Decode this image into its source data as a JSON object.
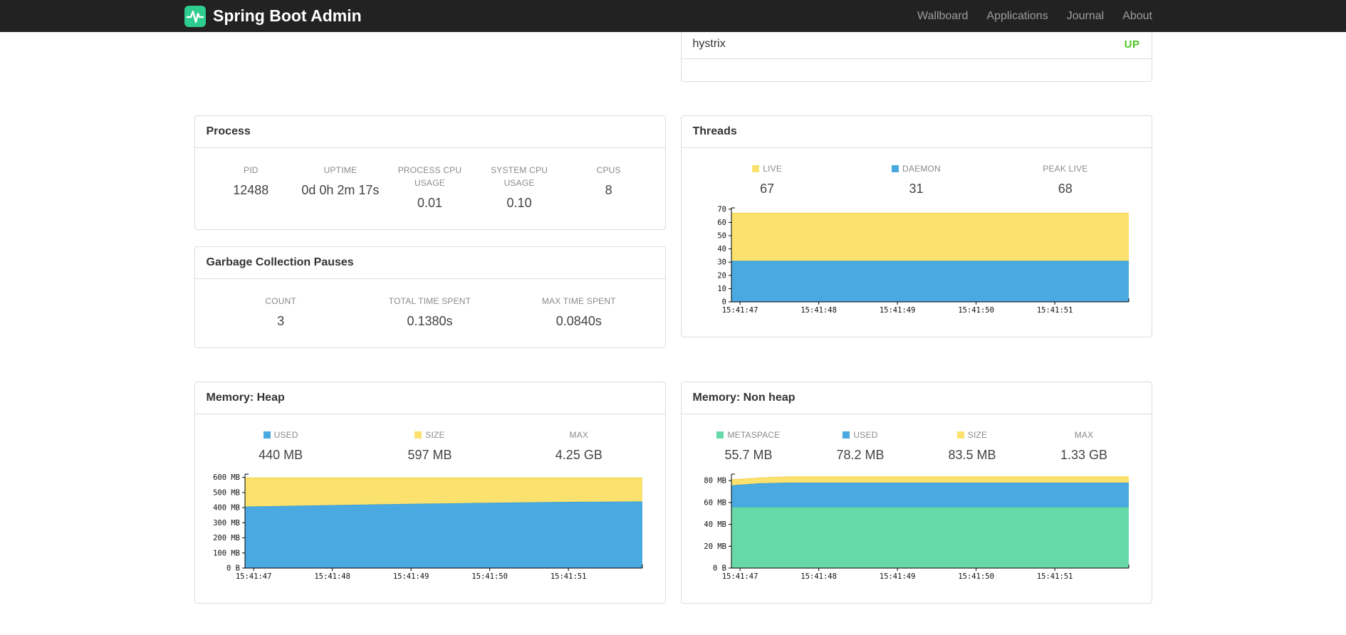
{
  "navbar": {
    "brand": "Spring Boot Admin",
    "links": [
      {
        "label": "Wallboard"
      },
      {
        "label": "Applications"
      },
      {
        "label": "Journal"
      },
      {
        "label": "About"
      }
    ]
  },
  "colors": {
    "brand_green": "#2ecc8f",
    "status_up": "#4bc51d",
    "chart_blue": "#4aa9e0",
    "chart_yellow": "#fbe26e",
    "chart_green": "#67d9a8"
  },
  "health_panel": {
    "rows": [
      {
        "name": "hystrix",
        "status": "UP",
        "status_color": "#4bc51d"
      }
    ]
  },
  "panels": {
    "process": {
      "title": "Process",
      "metrics": [
        {
          "label": "PID",
          "value": "12488"
        },
        {
          "label": "UPTIME",
          "value": "0d 0h 2m 17s"
        },
        {
          "label": "PROCESS CPU USAGE",
          "value": "0.01"
        },
        {
          "label": "SYSTEM CPU USAGE",
          "value": "0.10"
        },
        {
          "label": "CPUS",
          "value": "8"
        }
      ]
    },
    "gc": {
      "title": "Garbage Collection Pauses",
      "metrics": [
        {
          "label": "COUNT",
          "value": "3"
        },
        {
          "label": "TOTAL TIME SPENT",
          "value": "0.1380s"
        },
        {
          "label": "MAX TIME SPENT",
          "value": "0.0840s"
        }
      ]
    },
    "threads": {
      "title": "Threads",
      "metrics": [
        {
          "label": "LIVE",
          "value": "67",
          "color": "#fbe26e"
        },
        {
          "label": "DAEMON",
          "value": "31",
          "color": "#4aa9e0"
        },
        {
          "label": "PEAK LIVE",
          "value": "68"
        }
      ]
    },
    "heap": {
      "title": "Memory: Heap",
      "metrics": [
        {
          "label": "USED",
          "value": "440 MB",
          "color": "#4aa9e0"
        },
        {
          "label": "SIZE",
          "value": "597 MB",
          "color": "#fbe26e"
        },
        {
          "label": "MAX",
          "value": "4.25 GB"
        }
      ]
    },
    "nonheap": {
      "title": "Memory: Non heap",
      "metrics": [
        {
          "label": "METASPACE",
          "value": "55.7 MB",
          "color": "#67d9a8"
        },
        {
          "label": "USED",
          "value": "78.2 MB",
          "color": "#4aa9e0"
        },
        {
          "label": "SIZE",
          "value": "83.5 MB",
          "color": "#fbe26e"
        },
        {
          "label": "MAX",
          "value": "1.33 GB"
        }
      ]
    }
  },
  "chart_data": [
    {
      "id": "threads",
      "type": "area",
      "stacked": true,
      "title": "Threads",
      "xlabel": "",
      "ylabel": "",
      "xlim": [
        -0.11,
        4.94
      ],
      "ymax": 71,
      "y_ticks": [
        0,
        10,
        20,
        30,
        40,
        50,
        60,
        70
      ],
      "y_tick_labels": [
        "0",
        "10",
        "20",
        "30",
        "40",
        "50",
        "60",
        "70"
      ],
      "x_tick_pos": [
        0,
        1,
        2,
        3,
        4
      ],
      "x_tick_labels": [
        "15:41:47",
        "15:41:48",
        "15:41:49",
        "15:41:50",
        "15:41:51"
      ],
      "x": [
        -0.11,
        4.94
      ],
      "series": [
        {
          "name": "DAEMON",
          "color": "#4aa9e0",
          "stroke": "#2b93cf",
          "tops": [
            31,
            31
          ]
        },
        {
          "name": "LIVE",
          "color": "#fbe26e",
          "stroke": "#f0d14a",
          "tops": [
            67,
            67
          ]
        }
      ]
    },
    {
      "id": "heap",
      "type": "area",
      "stacked": true,
      "title": "Memory: Heap",
      "xlabel": "",
      "ylabel": "",
      "xlim": [
        -0.11,
        4.94
      ],
      "ymax": 622,
      "y_ticks": [
        0,
        100,
        200,
        300,
        400,
        500,
        600
      ],
      "y_tick_labels": [
        "0 B",
        "100 MB",
        "200 MB",
        "300 MB",
        "400 MB",
        "500 MB",
        "600 MB"
      ],
      "x_tick_pos": [
        0,
        1,
        2,
        3,
        4
      ],
      "x_tick_labels": [
        "15:41:47",
        "15:41:48",
        "15:41:49",
        "15:41:50",
        "15:41:51"
      ],
      "x": [
        -0.11,
        1,
        2,
        3,
        4,
        4.94
      ],
      "series": [
        {
          "name": "USED",
          "color": "#4aa9e0",
          "stroke": "#2b93cf",
          "tops": [
            407,
            417,
            425,
            432,
            438,
            441
          ]
        },
        {
          "name": "SIZE",
          "color": "#fbe26e",
          "stroke": "#f0d14a",
          "tops": [
            597,
            597,
            597,
            597,
            597,
            597
          ]
        }
      ]
    },
    {
      "id": "nonheap",
      "type": "area",
      "stacked": true,
      "title": "Memory: Non heap",
      "xlabel": "",
      "ylabel": "",
      "xlim": [
        -0.11,
        4.94
      ],
      "ymax": 86,
      "y_ticks": [
        0,
        20,
        40,
        60,
        80
      ],
      "y_tick_labels": [
        "0 B",
        "20 MB",
        "40 MB",
        "60 MB",
        "80 MB"
      ],
      "x_tick_pos": [
        0,
        1,
        2,
        3,
        4
      ],
      "x_tick_labels": [
        "15:41:47",
        "15:41:48",
        "15:41:49",
        "15:41:50",
        "15:41:51"
      ],
      "x": [
        -0.11,
        0.25,
        0.6,
        2,
        3.5,
        4.94
      ],
      "series": [
        {
          "name": "METASPACE",
          "color": "#67d9a8",
          "stroke": "#45c78e",
          "tops": [
            55.7,
            55.7,
            55.7,
            55.7,
            55.7,
            55.7
          ]
        },
        {
          "name": "USED",
          "color": "#4aa9e0",
          "stroke": "#2b93cf",
          "tops": [
            75.8,
            77.6,
            78.2,
            78.2,
            78.2,
            78.2
          ]
        },
        {
          "name": "SIZE",
          "color": "#fbe26e",
          "stroke": "#f0d14a",
          "tops": [
            80.8,
            82.6,
            83.5,
            83.5,
            83.5,
            83.5
          ]
        }
      ]
    }
  ]
}
